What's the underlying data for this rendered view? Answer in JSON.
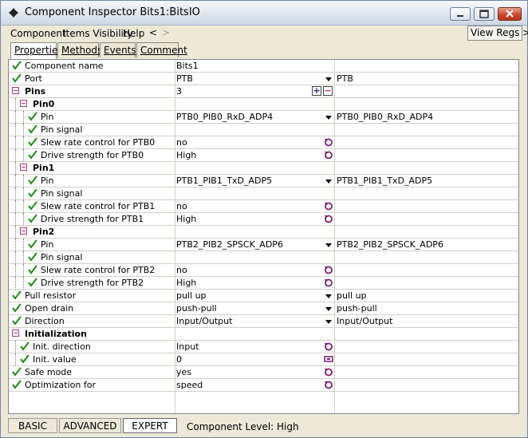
{
  "window": {
    "title": "Component Inspector Bits1:BitsIO"
  },
  "menu": {
    "items": [
      "Component",
      "Items Visibility",
      "Help"
    ],
    "back": "<",
    "forward": ">"
  },
  "view_regs": "View Regs >",
  "tabs": [
    "Properties",
    "Methods",
    "Events",
    "Comment"
  ],
  "active_tab": "Properties",
  "rows": [
    {
      "type": "prop",
      "indent": 0,
      "name": "Component name",
      "value": "Bits1",
      "extra": "",
      "control": "none",
      "checked": true
    },
    {
      "type": "prop",
      "indent": 0,
      "name": "Port",
      "value": "PTB",
      "extra": "PTB",
      "control": "dropdown",
      "checked": true
    },
    {
      "type": "group",
      "indent": 0,
      "name": "Pins",
      "value": "3",
      "extra": "",
      "control": "plusminus",
      "checked": false
    },
    {
      "type": "group",
      "indent": 1,
      "name": "Pin0",
      "value": "",
      "extra": "",
      "control": "none",
      "checked": false
    },
    {
      "type": "prop",
      "indent": 2,
      "name": "Pin",
      "value": "PTB0_PIB0_RxD_ADP4",
      "extra": "PTB0_PIB0_RxD_ADP4",
      "control": "dropdown",
      "checked": true
    },
    {
      "type": "prop",
      "indent": 2,
      "name": "Pin signal",
      "value": "",
      "extra": "",
      "control": "none",
      "checked": true
    },
    {
      "type": "prop",
      "indent": 2,
      "name": "Slew rate control for PTB0",
      "value": "no",
      "extra": "",
      "control": "reset",
      "checked": true
    },
    {
      "type": "prop",
      "indent": 2,
      "name": "Drive strength for PTB0",
      "value": "High",
      "extra": "",
      "control": "reset",
      "checked": true
    },
    {
      "type": "group",
      "indent": 1,
      "name": "Pin1",
      "value": "",
      "extra": "",
      "control": "none",
      "checked": false
    },
    {
      "type": "prop",
      "indent": 2,
      "name": "Pin",
      "value": "PTB1_PIB1_TxD_ADP5",
      "extra": "PTB1_PIB1_TxD_ADP5",
      "control": "dropdown",
      "checked": true
    },
    {
      "type": "prop",
      "indent": 2,
      "name": "Pin signal",
      "value": "",
      "extra": "",
      "control": "none",
      "checked": true
    },
    {
      "type": "prop",
      "indent": 2,
      "name": "Slew rate control for PTB1",
      "value": "no",
      "extra": "",
      "control": "reset",
      "checked": true
    },
    {
      "type": "prop",
      "indent": 2,
      "name": "Drive strength for PTB1",
      "value": "High",
      "extra": "",
      "control": "reset",
      "checked": true
    },
    {
      "type": "group",
      "indent": 1,
      "name": "Pin2",
      "value": "",
      "extra": "",
      "control": "none",
      "checked": false
    },
    {
      "type": "prop",
      "indent": 2,
      "name": "Pin",
      "value": "PTB2_PIB2_SPSCK_ADP6",
      "extra": "PTB2_PIB2_SPSCK_ADP6",
      "control": "dropdown",
      "checked": true
    },
    {
      "type": "prop",
      "indent": 2,
      "name": "Pin signal",
      "value": "",
      "extra": "",
      "control": "none",
      "checked": true
    },
    {
      "type": "prop",
      "indent": 2,
      "name": "Slew rate control for PTB2",
      "value": "no",
      "extra": "",
      "control": "reset",
      "checked": true
    },
    {
      "type": "prop",
      "indent": 2,
      "name": "Drive strength for PTB2",
      "value": "High",
      "extra": "",
      "control": "reset",
      "checked": true
    },
    {
      "type": "prop",
      "indent": 0,
      "name": "Pull resistor",
      "value": "pull up",
      "extra": "pull up",
      "control": "dropdown",
      "checked": true
    },
    {
      "type": "prop",
      "indent": 0,
      "name": "Open drain",
      "value": "push-pull",
      "extra": "push-pull",
      "control": "dropdown",
      "checked": true
    },
    {
      "type": "prop",
      "indent": 0,
      "name": "Direction",
      "value": "Input/Output",
      "extra": "Input/Output",
      "control": "dropdown",
      "checked": true
    },
    {
      "type": "group",
      "indent": 0,
      "name": "Initialization",
      "value": "",
      "extra": "",
      "control": "none",
      "checked": false
    },
    {
      "type": "prop",
      "indent": 1,
      "name": "Init. direction",
      "value": "Input",
      "extra": "",
      "control": "reset",
      "checked": true
    },
    {
      "type": "prop",
      "indent": 1,
      "name": "Init. value",
      "value": "0",
      "extra": "",
      "control": "bits",
      "checked": true
    },
    {
      "type": "prop",
      "indent": 0,
      "name": "Safe mode",
      "value": "yes",
      "extra": "",
      "control": "reset",
      "checked": true
    },
    {
      "type": "prop",
      "indent": 0,
      "name": "Optimization for",
      "value": "speed",
      "extra": "",
      "control": "reset",
      "checked": true
    }
  ],
  "status": {
    "modes": [
      "BASIC",
      "ADVANCED",
      "EXPERT"
    ],
    "active_mode": "EXPERT",
    "level_text": "Component Level: High"
  },
  "colors": {
    "check": "#1e8a1e",
    "expander": "#b13a76",
    "reset_icon": "#7a1f6a"
  }
}
